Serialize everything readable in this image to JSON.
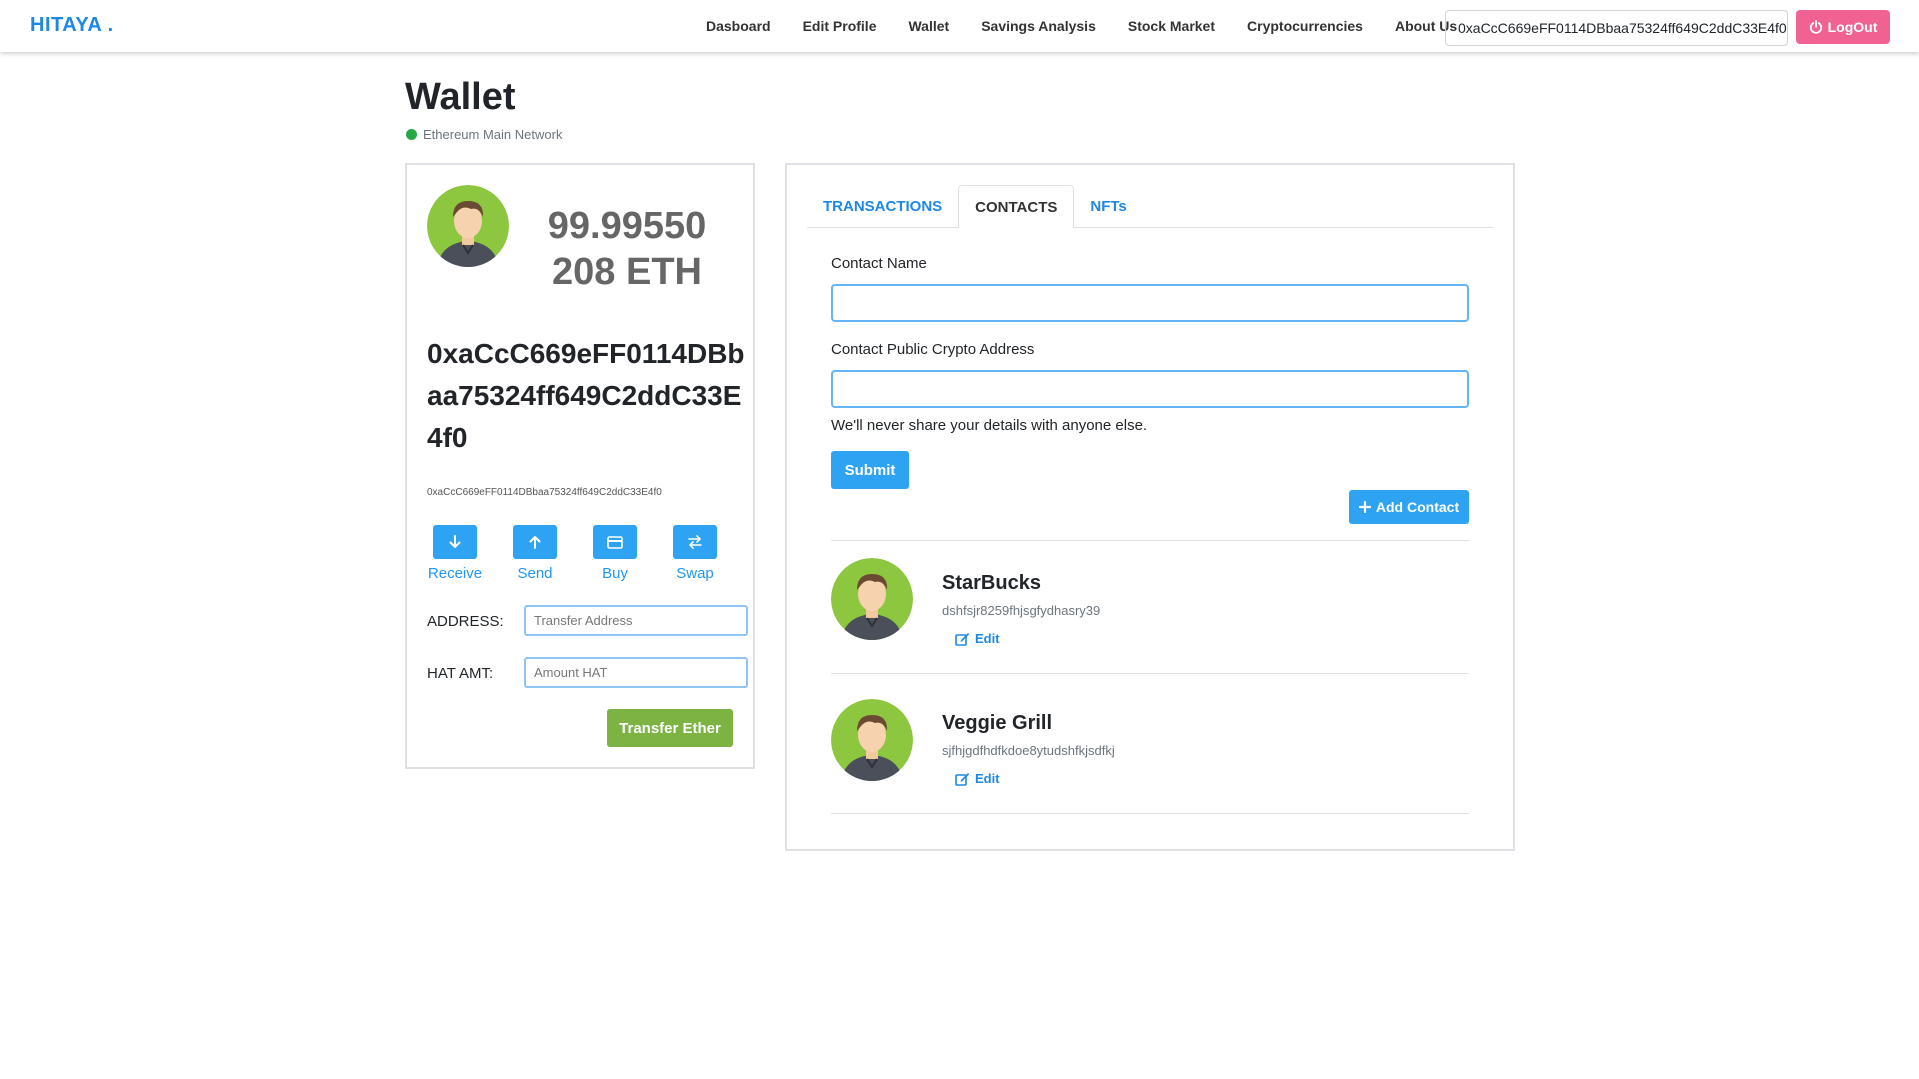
{
  "navbar": {
    "brand": "HITAYA .",
    "links": [
      "Dasboard",
      "Edit Profile",
      "Wallet",
      "Savings Analysis",
      "Stock Market",
      "Cryptocurrencies",
      "About Us"
    ],
    "address": "0xaCcC669eFF0114DBbaa75324ff649C2ddC33E4f0",
    "logout_label": "LogOut",
    "logout_color": "#f06292"
  },
  "page": {
    "title": "Wallet",
    "network": "Ethereum Main Network",
    "network_color": "#28a745"
  },
  "wallet": {
    "balance": "99.99550 208 ETH",
    "address_large": "0xaCcC669eFF0114DBbaa75324ff649C2ddC33E4f0",
    "address_small": "0xaCcC669eFF0114DBbaa75324ff649C2ddC33E4f0",
    "actions": [
      {
        "label": "Receive",
        "icon": "arrow-down-icon"
      },
      {
        "label": "Send",
        "icon": "arrow-up-icon"
      },
      {
        "label": "Buy",
        "icon": "credit-card-icon"
      },
      {
        "label": "Swap",
        "icon": "swap-arrows-icon"
      }
    ],
    "address_label": "ADDRESS:",
    "address_placeholder": "Transfer Address",
    "amount_label": "HAT AMT:",
    "amount_placeholder": "Amount HAT",
    "transfer_label": "Transfer Ether",
    "transfer_color": "#7cb342"
  },
  "contacts_panel": {
    "tabs": [
      "TRANSACTIONS",
      "CONTACTS",
      "NFTs"
    ],
    "active_tab": "CONTACTS",
    "name_label": "Contact Name",
    "name_value": "",
    "address_label": "Contact Public Crypto Address",
    "address_value": "",
    "help_text": "We'll never share your details with anyone else.",
    "submit_label": "Submit",
    "add_contact_label": "Add Contact",
    "accent_color": "#2ea3f2",
    "contacts": [
      {
        "name": "StarBucks",
        "address": "dshfsjr8259fhjsgfydhasry39",
        "edit_label": "Edit"
      },
      {
        "name": "Veggie Grill",
        "address": "sjfhjgdfhdfkdoe8ytudshfkjsdfkj",
        "edit_label": "Edit"
      }
    ]
  }
}
